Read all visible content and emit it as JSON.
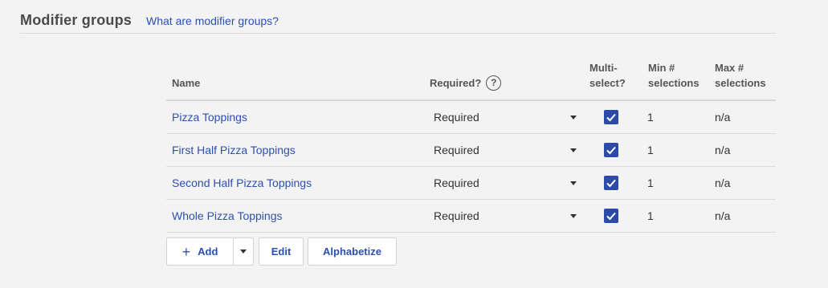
{
  "header": {
    "title": "Modifier groups",
    "help_link": "What are modifier groups?"
  },
  "table": {
    "columns": {
      "name": "Name",
      "required": "Required?",
      "required_help_icon": "?",
      "multi_line1": "Multi-",
      "multi_line2": "select?",
      "min_line1": "Min #",
      "min_line2": "selections",
      "max_line1": "Max #",
      "max_line2": "selections"
    },
    "rows": [
      {
        "name": "Pizza Toppings",
        "required": "Required",
        "multi_select": true,
        "min": "1",
        "max": "n/a"
      },
      {
        "name": "First Half Pizza Toppings",
        "required": "Required",
        "multi_select": true,
        "min": "1",
        "max": "n/a"
      },
      {
        "name": "Second Half Pizza Toppings",
        "required": "Required",
        "multi_select": true,
        "min": "1",
        "max": "n/a"
      },
      {
        "name": "Whole Pizza Toppings",
        "required": "Required",
        "multi_select": true,
        "min": "1",
        "max": "n/a"
      }
    ]
  },
  "buttons": {
    "add_icon": "+",
    "add": "Add",
    "edit": "Edit",
    "alphabetize": "Alphabetize"
  },
  "colors": {
    "accent": "#2d4fb0",
    "checkbox": "#2c4aa8",
    "background": "#f3f3f3"
  }
}
